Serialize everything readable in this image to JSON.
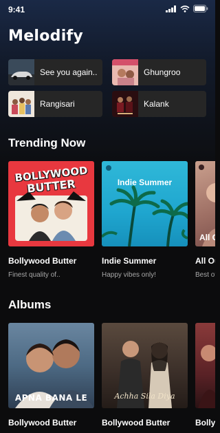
{
  "status": {
    "time": "9:41"
  },
  "app": {
    "title": "Melodify"
  },
  "quick_picks": [
    {
      "label": "See you again..",
      "thumb": "car"
    },
    {
      "label": "Ghungroo",
      "thumb": "ghungroo"
    },
    {
      "label": "Rangisari",
      "thumb": "rangisari"
    },
    {
      "label": "Kalank",
      "thumb": "kalank"
    }
  ],
  "trending": {
    "heading": "Trending Now",
    "items": [
      {
        "title": "Bollywood Butter",
        "subtitle": "Finest quality of..",
        "cover_text": [
          "BOLLYWOOD",
          "BUTTER"
        ]
      },
      {
        "title": "Indie Summer",
        "subtitle": "Happy vibes only!",
        "cover_text": [
          "Indie Summer"
        ]
      },
      {
        "title": "All Ou",
        "subtitle": "Best of",
        "cover_text": [
          "All Ou"
        ]
      }
    ]
  },
  "albums": {
    "heading": "Albums",
    "items": [
      {
        "title": "Bollywood Butter",
        "cover_text": [
          "APNA BANA LE"
        ]
      },
      {
        "title": "Bollywood Butter",
        "cover_text": [
          "Achha Sila Diya"
        ]
      },
      {
        "title": "Bolly",
        "cover_text": []
      }
    ]
  },
  "colors": {
    "background": "#0c0c0d",
    "tile": "#262626",
    "subtitle": "#a8a8a8"
  }
}
